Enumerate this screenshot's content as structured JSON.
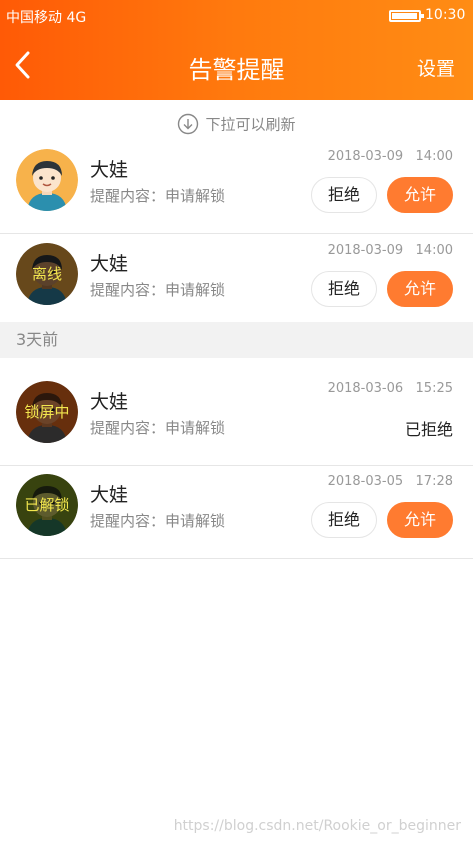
{
  "status_bar": {
    "carrier": "中国移动  4G",
    "time": "10:30",
    "battery_level": 0.9
  },
  "header": {
    "title": "告警提醒",
    "settings_label": "设置"
  },
  "refresh_hint": "下拉可以刷新",
  "labels": {
    "reject": "拒绝",
    "allow": "允许",
    "rejected": "已拒绝"
  },
  "section_header": "3天前",
  "alerts": [
    {
      "name": "大娃",
      "content": "提醒内容：申请解锁",
      "date": "2018-03-09",
      "time": "14:00",
      "status": "",
      "state": "pending"
    },
    {
      "name": "大娃",
      "content": "提醒内容：申请解锁",
      "date": "2018-03-09",
      "time": "14:00",
      "status": "离线",
      "state": "pending"
    },
    {
      "name": "大娃",
      "content": "提醒内容：申请解锁",
      "date": "2018-03-06",
      "time": "15:25",
      "status": "锁屏中",
      "state": "rejected"
    },
    {
      "name": "大娃",
      "content": "提醒内容：申请解锁",
      "date": "2018-03-05",
      "time": "17:28",
      "status": "已解锁",
      "state": "pending"
    }
  ],
  "watermark": "https://blog.csdn.net/Rookie_or_beginner"
}
